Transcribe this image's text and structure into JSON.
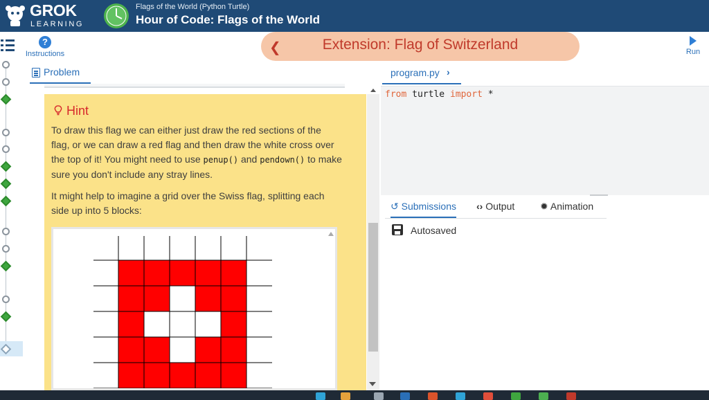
{
  "header": {
    "logo_text": "GROK",
    "logo_sub": "LEARNING",
    "course_subtitle": "Flags of the World (Python Turtle)",
    "course_title": "Hour of Code: Flags of the World"
  },
  "toolbar": {
    "instructions_label": "Instructions",
    "extension_title": "Extension: Flag of Switzerland",
    "run_label": "Run"
  },
  "problem_tab": {
    "label": "Problem"
  },
  "hint": {
    "title": "Hint",
    "p1_a": "To draw this flag we can either just draw the red sections of the flag, or we can draw a red flag and then draw the white cross over the top of it! You might need to use ",
    "p1_code1": "penup()",
    "p1_b": " and ",
    "p1_code2": "pendown()",
    "p1_c": " to make sure you don't include any stray lines.",
    "p2": "It might help to imagine a grid over the Swiss flag, splitting each side up into 5 blocks:"
  },
  "grid_image": {
    "red": "#ff0000",
    "rows": [
      [
        1,
        1,
        1,
        1,
        1
      ],
      [
        1,
        1,
        0,
        1,
        1
      ],
      [
        1,
        0,
        0,
        0,
        1
      ],
      [
        1,
        1,
        0,
        1,
        1
      ],
      [
        1,
        1,
        1,
        1,
        1
      ]
    ]
  },
  "editor": {
    "file_tab": "program.py",
    "code": {
      "from": "from",
      "module": " turtle ",
      "import": "import",
      "star": " *"
    }
  },
  "output_tabs": {
    "submissions": "Submissions",
    "output": "Output",
    "animation": "Animation"
  },
  "status": {
    "autosaved": "Autosaved"
  },
  "colors": {
    "header_bg": "#1f4a76",
    "accent_blue": "#2a6fb8",
    "hint_bg": "#fbe289",
    "hint_title": "#d6282c",
    "extension_pill": "#f6c6a8",
    "keyword": "#e0663b",
    "node_green": "#3fa63f"
  }
}
